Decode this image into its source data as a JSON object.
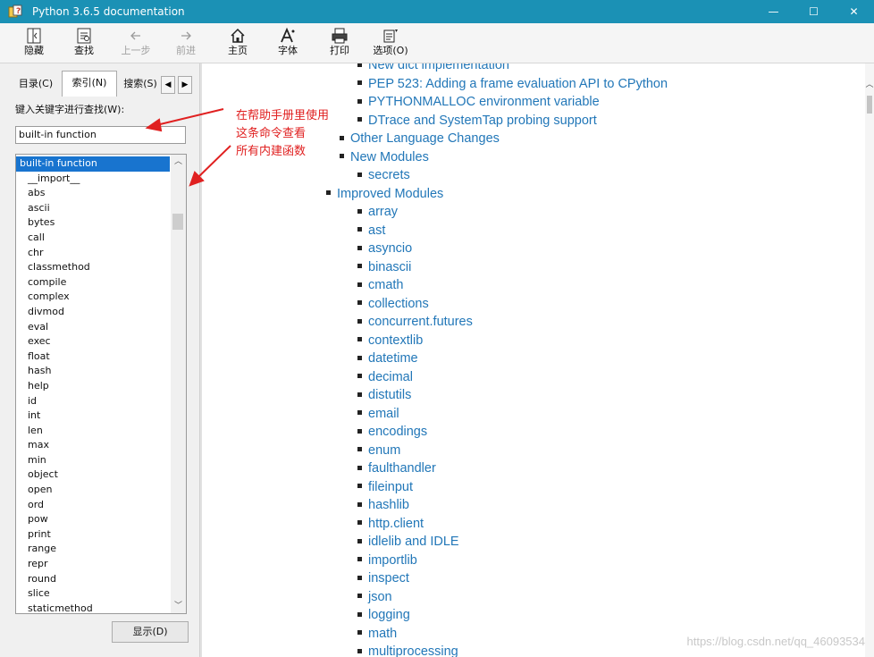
{
  "window": {
    "title": "Python 3.6.5 documentation",
    "controls": {
      "minimize": "—",
      "maximize": "☐",
      "close": "✕"
    }
  },
  "toolbar": {
    "hide": "隐藏",
    "locate": "查找",
    "back": "上一步",
    "forward": "前进",
    "home": "主页",
    "font": "字体",
    "print": "打印",
    "options": "选项(O)"
  },
  "left_pane": {
    "tabs": {
      "contents": "目录(C)",
      "index": "索引(N)",
      "search": "搜索(S)"
    },
    "keyword_label": "键入关键字进行查找(W):",
    "keyword_value": "built-in function",
    "index_items": [
      "built-in function",
      "__import__",
      "abs",
      "ascii",
      "bytes",
      "call",
      "chr",
      "classmethod",
      "compile",
      "complex",
      "divmod",
      "eval",
      "exec",
      "float",
      "hash",
      "help",
      "id",
      "int",
      "len",
      "max",
      "min",
      "object",
      "open",
      "ord",
      "pow",
      "print",
      "range",
      "repr",
      "round",
      "slice",
      "staticmethod"
    ],
    "selected_index": 0,
    "show_button": "显示(D)"
  },
  "annotation": {
    "line1": "在帮助手册里使用",
    "line2": "这条命令查看",
    "line3": "所有内建函数"
  },
  "content": {
    "entries": [
      {
        "level": 2,
        "text": "New dict implementation"
      },
      {
        "level": 2,
        "text": "PEP 523: Adding a frame evaluation API to CPython"
      },
      {
        "level": 2,
        "text": "PYTHONMALLOC environment variable"
      },
      {
        "level": 2,
        "text": "DTrace and SystemTap probing support"
      },
      {
        "level": 1,
        "text": "Other Language Changes"
      },
      {
        "level": 1,
        "text": "New Modules"
      },
      {
        "level": 2,
        "text": "secrets"
      },
      {
        "level": 0,
        "text": "Improved Modules"
      },
      {
        "level": 2,
        "text": "array"
      },
      {
        "level": 2,
        "text": "ast"
      },
      {
        "level": 2,
        "text": "asyncio"
      },
      {
        "level": 2,
        "text": "binascii"
      },
      {
        "level": 2,
        "text": "cmath"
      },
      {
        "level": 2,
        "text": "collections"
      },
      {
        "level": 2,
        "text": "concurrent.futures"
      },
      {
        "level": 2,
        "text": "contextlib"
      },
      {
        "level": 2,
        "text": "datetime"
      },
      {
        "level": 2,
        "text": "decimal"
      },
      {
        "level": 2,
        "text": "distutils"
      },
      {
        "level": 2,
        "text": "email"
      },
      {
        "level": 2,
        "text": "encodings"
      },
      {
        "level": 2,
        "text": "enum"
      },
      {
        "level": 2,
        "text": "faulthandler"
      },
      {
        "level": 2,
        "text": "fileinput"
      },
      {
        "level": 2,
        "text": "hashlib"
      },
      {
        "level": 2,
        "text": "http.client"
      },
      {
        "level": 2,
        "text": "idlelib and IDLE"
      },
      {
        "level": 2,
        "text": "importlib"
      },
      {
        "level": 2,
        "text": "inspect"
      },
      {
        "level": 2,
        "text": "json"
      },
      {
        "level": 2,
        "text": "logging"
      },
      {
        "level": 2,
        "text": "math"
      },
      {
        "level": 2,
        "text": "multiprocessing"
      }
    ]
  },
  "watermark": "https://blog.csdn.net/qq_46093534",
  "colors": {
    "titlebar": "#1b91b5",
    "link": "#2277b8",
    "selection": "#1874cf",
    "annotation": "#e02020"
  }
}
